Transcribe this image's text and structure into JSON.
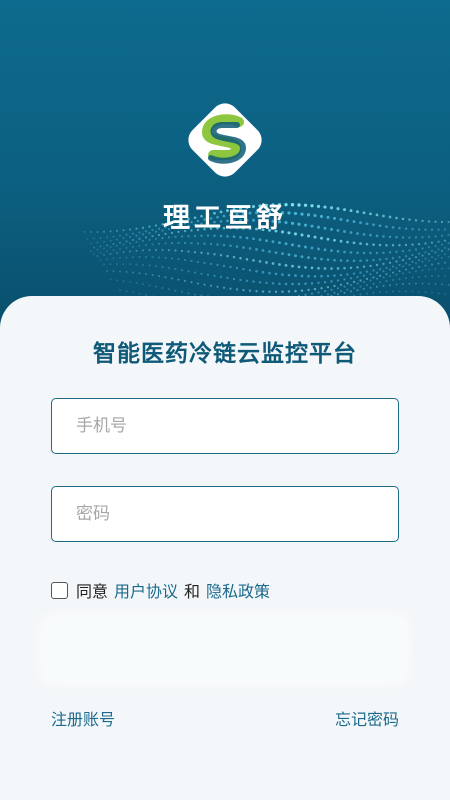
{
  "brand": {
    "name": "理工亘舒"
  },
  "login": {
    "title": "智能医药冷链云监控平台",
    "phone_placeholder": "手机号",
    "password_placeholder": "密码",
    "agree_prefix": "同意",
    "user_agreement": "用户协议",
    "and": "和",
    "privacy_policy": "隐私政策",
    "register": "注册账号",
    "forgot_password": "忘记密码"
  },
  "colors": {
    "header_bg": "#0c5f80",
    "accent": "#1b6a8c",
    "logo_green": "#8dc63f",
    "logo_blue": "#0e5a78"
  }
}
